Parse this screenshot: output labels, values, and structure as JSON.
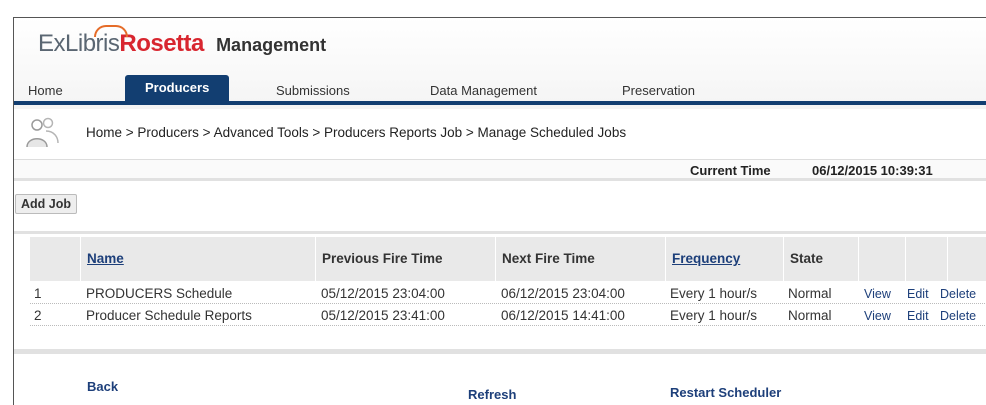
{
  "app": {
    "logo_exlibris": "ExLibris",
    "logo_rosetta": "Rosetta",
    "logo_management": "Management"
  },
  "tabs": [
    {
      "label": "Home"
    },
    {
      "label": "Producers"
    },
    {
      "label": "Submissions"
    },
    {
      "label": "Data Management"
    },
    {
      "label": "Preservation"
    }
  ],
  "breadcrumb": "Home > Producers > Advanced Tools > Producers Reports Job > Manage Scheduled Jobs",
  "current_time": {
    "label": "Current Time",
    "value": "06/12/2015 10:39:31"
  },
  "toolbar": {
    "add_job_label": "Add Job"
  },
  "table": {
    "headers": {
      "name": "Name",
      "previous_fire": "Previous Fire Time",
      "next_fire": "Next Fire Time",
      "frequency": "Frequency",
      "state": "State"
    },
    "rows": [
      {
        "index": "1",
        "name": "PRODUCERS Schedule",
        "previous_fire": "05/12/2015 23:04:00",
        "next_fire": "06/12/2015 23:04:00",
        "frequency": "Every 1 hour/s",
        "state": "Normal",
        "view": "View",
        "edit": "Edit",
        "delete": "Delete"
      },
      {
        "index": "2",
        "name": "Producer Schedule Reports",
        "previous_fire": "05/12/2015 23:41:00",
        "next_fire": "06/12/2015 14:41:00",
        "frequency": "Every 1 hour/s",
        "state": "Normal",
        "view": "View",
        "edit": "Edit",
        "delete": "Delete"
      }
    ]
  },
  "footer": {
    "back": "Back",
    "refresh": "Refresh",
    "restart_scheduler": "Restart Scheduler"
  },
  "colors": {
    "nav_blue": "#123e71",
    "link_blue": "#1d3f7a",
    "logo_red": "#d8262f",
    "logo_orange": "#e56c29"
  }
}
